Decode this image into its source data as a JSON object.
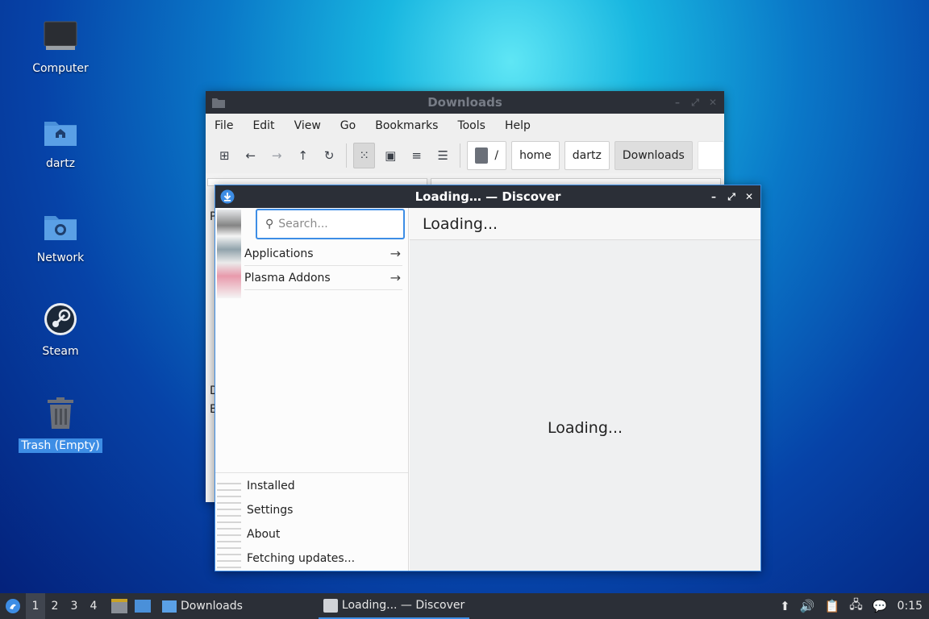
{
  "desktop": {
    "icons": [
      {
        "label": "Computer",
        "icon": "monitor-icon"
      },
      {
        "label": "dartz",
        "icon": "home-folder-icon"
      },
      {
        "label": "Network",
        "icon": "network-folder-icon"
      },
      {
        "label": "Steam",
        "icon": "steam-icon"
      },
      {
        "label": "Trash (Empty)",
        "icon": "trash-icon"
      }
    ]
  },
  "file_manager": {
    "title": "Downloads",
    "menu": [
      "File",
      "Edit",
      "View",
      "Go",
      "Bookmarks",
      "Tools",
      "Help"
    ],
    "toolbar_icons": [
      "new-tab-icon",
      "back-arrow-icon",
      "forward-arrow-icon",
      "up-arrow-icon",
      "reload-icon",
      "icon-view-icon",
      "thumbnail-view-icon",
      "compact-view-icon",
      "detailed-list-icon"
    ],
    "breadcrumb": {
      "root": "/",
      "parts": [
        "home",
        "dartz",
        "Downloads"
      ]
    },
    "peek_letters": [
      "P",
      "D",
      "B"
    ]
  },
  "discover": {
    "title": "Loading… — Discover",
    "search_placeholder": "Search...",
    "categories": [
      "Applications",
      "Plasma Addons"
    ],
    "nav": [
      "Installed",
      "Settings",
      "About",
      "Fetching updates..."
    ],
    "header": "Loading...",
    "body_status": "Loading..."
  },
  "taskbar": {
    "workspaces": [
      "1",
      "2",
      "3",
      "4"
    ],
    "tasks": [
      "Downloads",
      "Loading... — Discover"
    ],
    "clock": "0:15"
  },
  "colors": {
    "accent": "#3d8de5",
    "panel": "#2b2f37"
  }
}
